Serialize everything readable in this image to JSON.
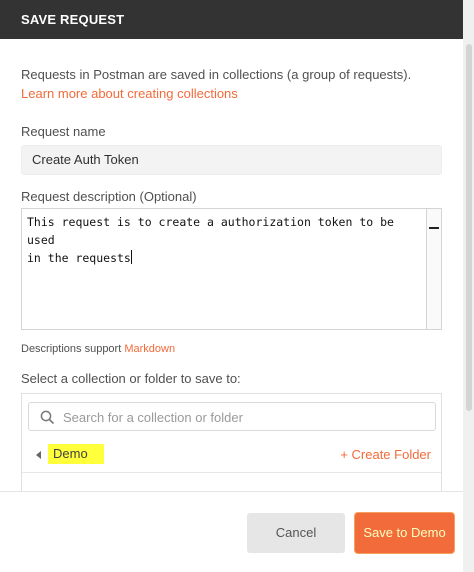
{
  "dialog": {
    "title": "SAVE REQUEST"
  },
  "intro": {
    "text": "Requests in Postman are saved in collections (a group of requests).",
    "link": "Learn more about creating collections"
  },
  "request_name": {
    "label": "Request name",
    "value": "Create Auth Token"
  },
  "request_description": {
    "label": "Request description (Optional)",
    "value": "This request is to create a authorization token to be used\nin the requests"
  },
  "markdown_note": {
    "text": "Descriptions support",
    "link": "Markdown"
  },
  "collection": {
    "label": "Select a collection or folder to save to:",
    "search_placeholder": "Search for a collection or folder",
    "selected": "Demo",
    "create_folder": "+ Create Folder"
  },
  "buttons": {
    "cancel": "Cancel",
    "save": "Save to Demo"
  },
  "colors": {
    "accent": "#f26b3a",
    "header_bg": "#333333",
    "highlight": "#ffff3c"
  }
}
